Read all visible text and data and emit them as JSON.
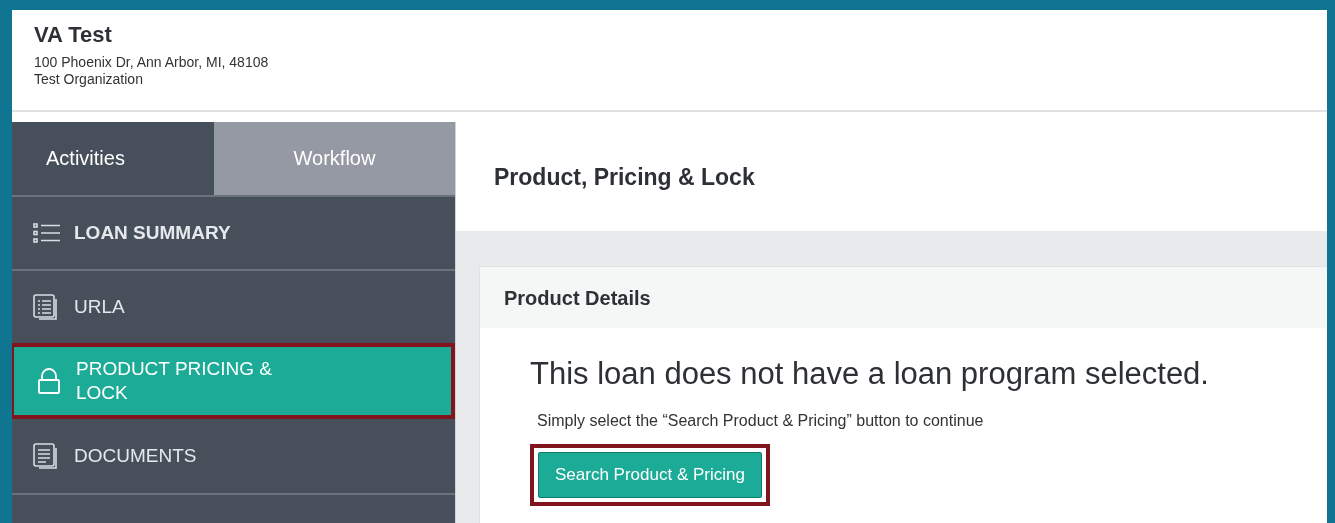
{
  "header": {
    "title": "VA Test",
    "address": "100 Phoenix Dr, Ann Arbor, MI, 48108",
    "organization": "Test Organization"
  },
  "tabs": [
    {
      "label": "Activities",
      "selected": true
    },
    {
      "label": "Workflow",
      "selected": false
    }
  ],
  "sidebar": {
    "items": [
      {
        "label": "LOAN SUMMARY",
        "kind": "list",
        "bold": true,
        "selected": false,
        "highlighted": false
      },
      {
        "label": "URLA",
        "kind": "form",
        "bold": false,
        "selected": false,
        "highlighted": false
      },
      {
        "label": "PRODUCT PRICING & LOCK",
        "kind": "lock",
        "bold": false,
        "selected": true,
        "highlighted": true
      },
      {
        "label": "DOCUMENTS",
        "kind": "document",
        "bold": false,
        "selected": false,
        "highlighted": false
      }
    ]
  },
  "page_title": "Product, Pricing & Lock",
  "card": {
    "title": "Product Details",
    "message": "This loan does not have a loan program selected.",
    "hint": "Simply select the “Search Product & Pricing” button to continue",
    "button": {
      "label": "Search Product & Pricing",
      "highlighted": true
    }
  }
}
